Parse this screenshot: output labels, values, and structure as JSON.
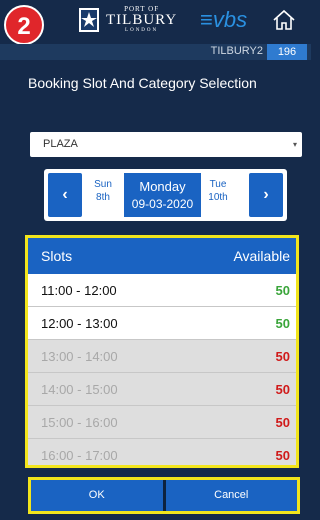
{
  "step_badge": "2",
  "header": {
    "logo_port": "PORT OF",
    "logo_name": "TILBURY",
    "logo_city": "LONDON",
    "vbs": "≡vbs",
    "home_icon": "home-icon"
  },
  "user": {
    "name": "TILBURY2",
    "number": "196"
  },
  "page_title": "Booking Slot And Category Selection",
  "category_select": {
    "value": "PLAZA",
    "caret": "▾"
  },
  "date_nav": {
    "prev_arrow": "‹",
    "next_arrow": "›",
    "prev_day": "Sun",
    "prev_date": "8th",
    "current_day": "Monday",
    "current_date": "09-03-2020",
    "next_day": "Tue",
    "next_date": "10th"
  },
  "slots": {
    "header_left": "Slots",
    "header_right": "Available",
    "rows": [
      {
        "time": "11:00 - 12:00",
        "count": "50"
      },
      {
        "time": "12:00 - 13:00",
        "count": "50"
      },
      {
        "time": "13:00 - 14:00",
        "count": "50"
      },
      {
        "time": "14:00 - 15:00",
        "count": "50"
      },
      {
        "time": "15:00 - 16:00",
        "count": "50"
      },
      {
        "time": "16:00 - 17:00",
        "count": "50"
      }
    ]
  },
  "actions": {
    "ok": "OK",
    "cancel": "Cancel"
  },
  "colors": {
    "background": "#152a4a",
    "primary_blue": "#1a63c2",
    "highlight_yellow": "#f2e51c",
    "available_green": "#3aa53a",
    "full_red": "#d01a1a"
  }
}
